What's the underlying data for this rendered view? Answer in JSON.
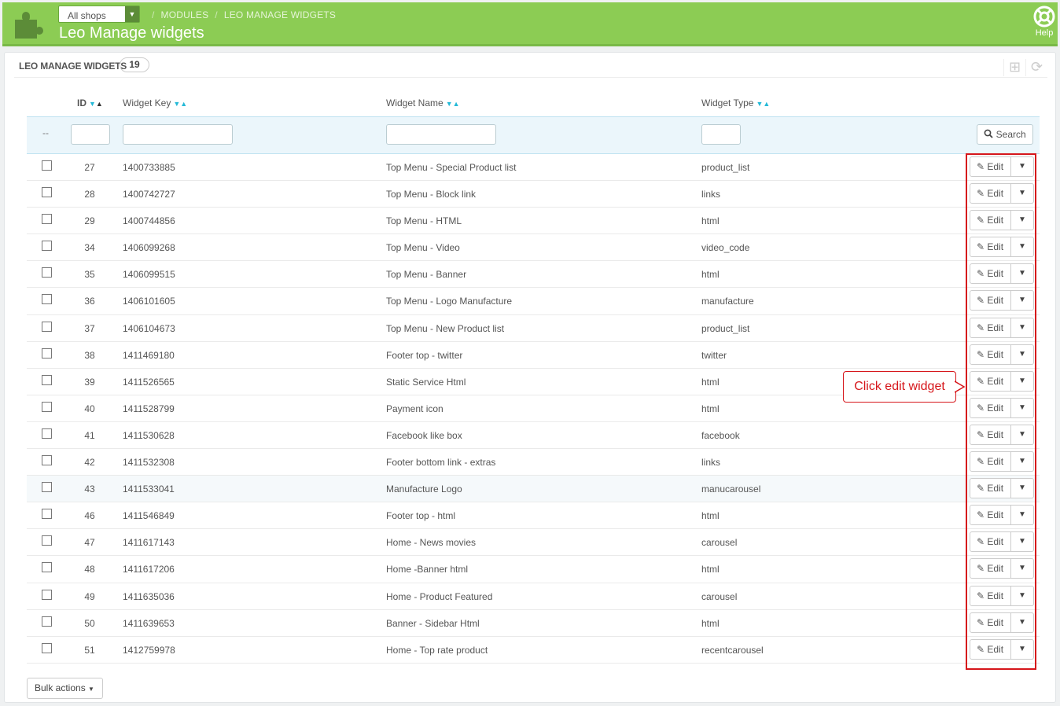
{
  "header": {
    "shop_selector": "All shops",
    "breadcrumb": [
      "MODULES",
      "LEO MANAGE WIDGETS"
    ],
    "title": "Leo Manage widgets",
    "help_label": "Help"
  },
  "panel": {
    "title": "LEO MANAGE WIDGETS",
    "count": "19"
  },
  "table": {
    "columns": {
      "id": "ID",
      "key": "Widget Key",
      "name": "Widget Name",
      "type": "Widget Type"
    },
    "filter_placeholder_dash": "--",
    "search_label": "Search",
    "edit_label": "Edit",
    "rows": [
      {
        "id": "27",
        "key": "1400733885",
        "name": "Top Menu - Special Product list",
        "type": "product_list"
      },
      {
        "id": "28",
        "key": "1400742727",
        "name": "Top Menu - Block link",
        "type": "links"
      },
      {
        "id": "29",
        "key": "1400744856",
        "name": "Top Menu - HTML",
        "type": "html"
      },
      {
        "id": "34",
        "key": "1406099268",
        "name": "Top Menu - Video",
        "type": "video_code"
      },
      {
        "id": "35",
        "key": "1406099515",
        "name": "Top Menu - Banner",
        "type": "html"
      },
      {
        "id": "36",
        "key": "1406101605",
        "name": "Top Menu - Logo Manufacture",
        "type": "manufacture"
      },
      {
        "id": "37",
        "key": "1406104673",
        "name": "Top Menu - New Product list",
        "type": "product_list"
      },
      {
        "id": "38",
        "key": "1411469180",
        "name": "Footer top - twitter",
        "type": "twitter"
      },
      {
        "id": "39",
        "key": "1411526565",
        "name": "Static Service Html",
        "type": "html"
      },
      {
        "id": "40",
        "key": "1411528799",
        "name": "Payment icon",
        "type": "html"
      },
      {
        "id": "41",
        "key": "1411530628",
        "name": "Facebook like box",
        "type": "facebook"
      },
      {
        "id": "42",
        "key": "1411532308",
        "name": "Footer bottom link - extras",
        "type": "links"
      },
      {
        "id": "43",
        "key": "1411533041",
        "name": "Manufacture Logo",
        "type": "manucarousel"
      },
      {
        "id": "46",
        "key": "1411546849",
        "name": "Footer top - html",
        "type": "html"
      },
      {
        "id": "47",
        "key": "1411617143",
        "name": "Home - News movies",
        "type": "carousel"
      },
      {
        "id": "48",
        "key": "1411617206",
        "name": "Home -Banner html",
        "type": "html"
      },
      {
        "id": "49",
        "key": "1411635036",
        "name": "Home - Product Featured",
        "type": "carousel"
      },
      {
        "id": "50",
        "key": "1411639653",
        "name": "Banner - Sidebar Html",
        "type": "html"
      },
      {
        "id": "51",
        "key": "1412759978",
        "name": "Home - Top rate product",
        "type": "recentcarousel"
      }
    ]
  },
  "annotation": {
    "callout": "Click edit widget"
  },
  "footer": {
    "bulk_actions": "Bulk actions"
  },
  "colors": {
    "header_green": "#8ccc54",
    "accent_blue": "#25b9d7",
    "annotation_red": "#d6161b"
  }
}
